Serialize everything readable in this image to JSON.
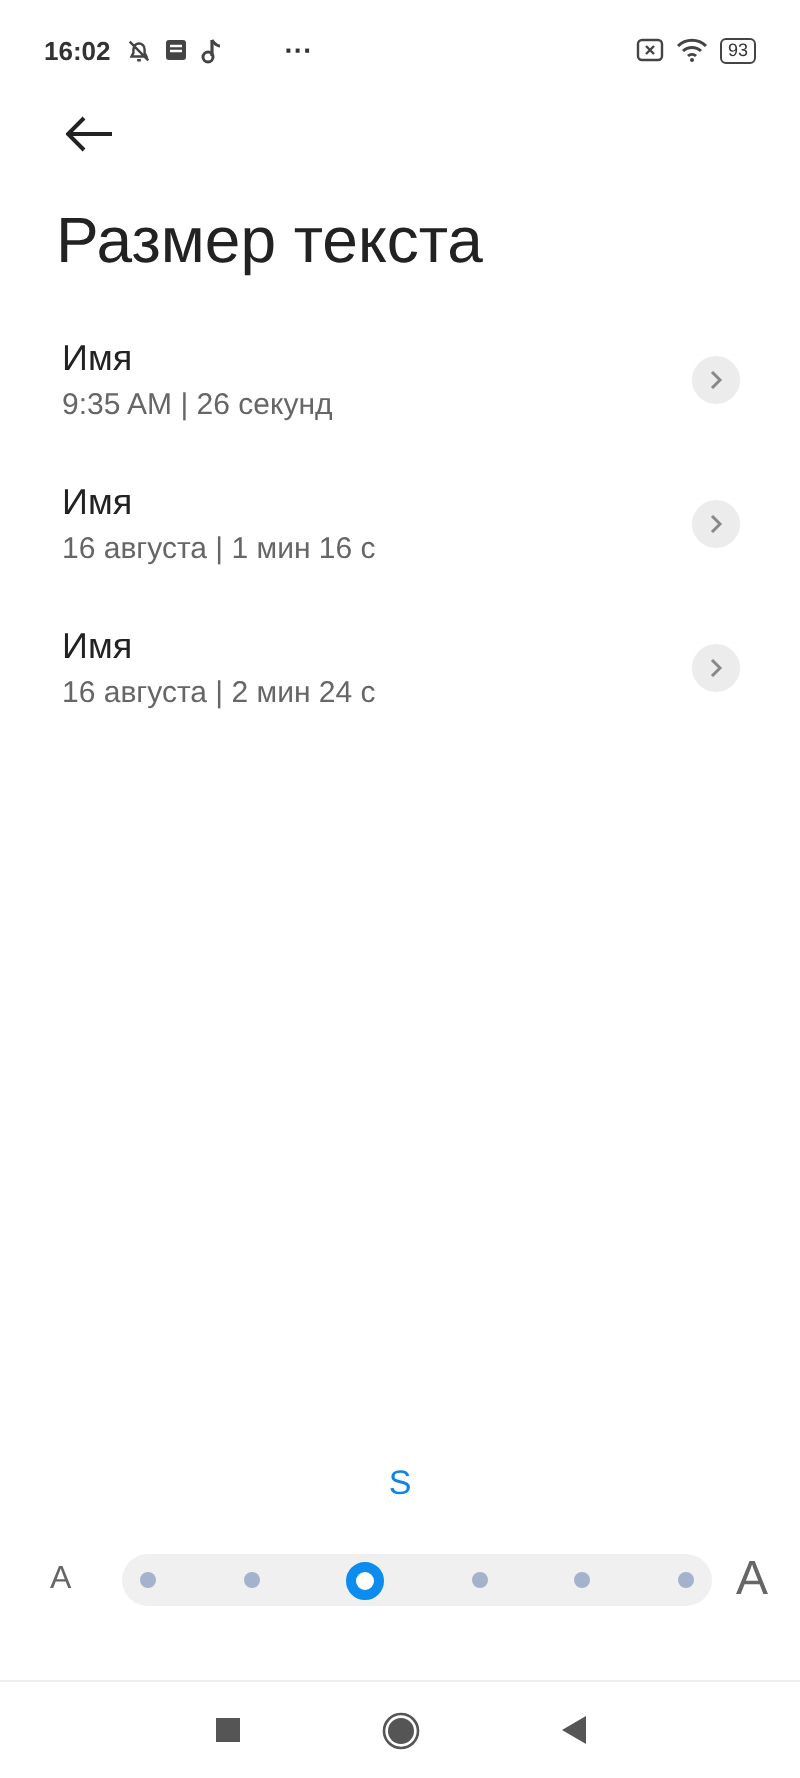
{
  "status_bar": {
    "time": "16:02",
    "more": "···",
    "battery": "93"
  },
  "title": "Размер текста",
  "items": [
    {
      "name": "Имя",
      "details": "9:35 AM | 26 секунд"
    },
    {
      "name": "Имя",
      "details": "16 августа | 1 мин 16 с"
    },
    {
      "name": "Имя",
      "details": "16 августа | 2 мин 24 с"
    }
  ],
  "size_slider": {
    "current_label": "S",
    "small_label": "A",
    "large_label": "A",
    "stops": [
      {
        "selected": false
      },
      {
        "selected": false
      },
      {
        "selected": true
      },
      {
        "selected": false
      },
      {
        "selected": false
      },
      {
        "selected": false
      }
    ]
  }
}
